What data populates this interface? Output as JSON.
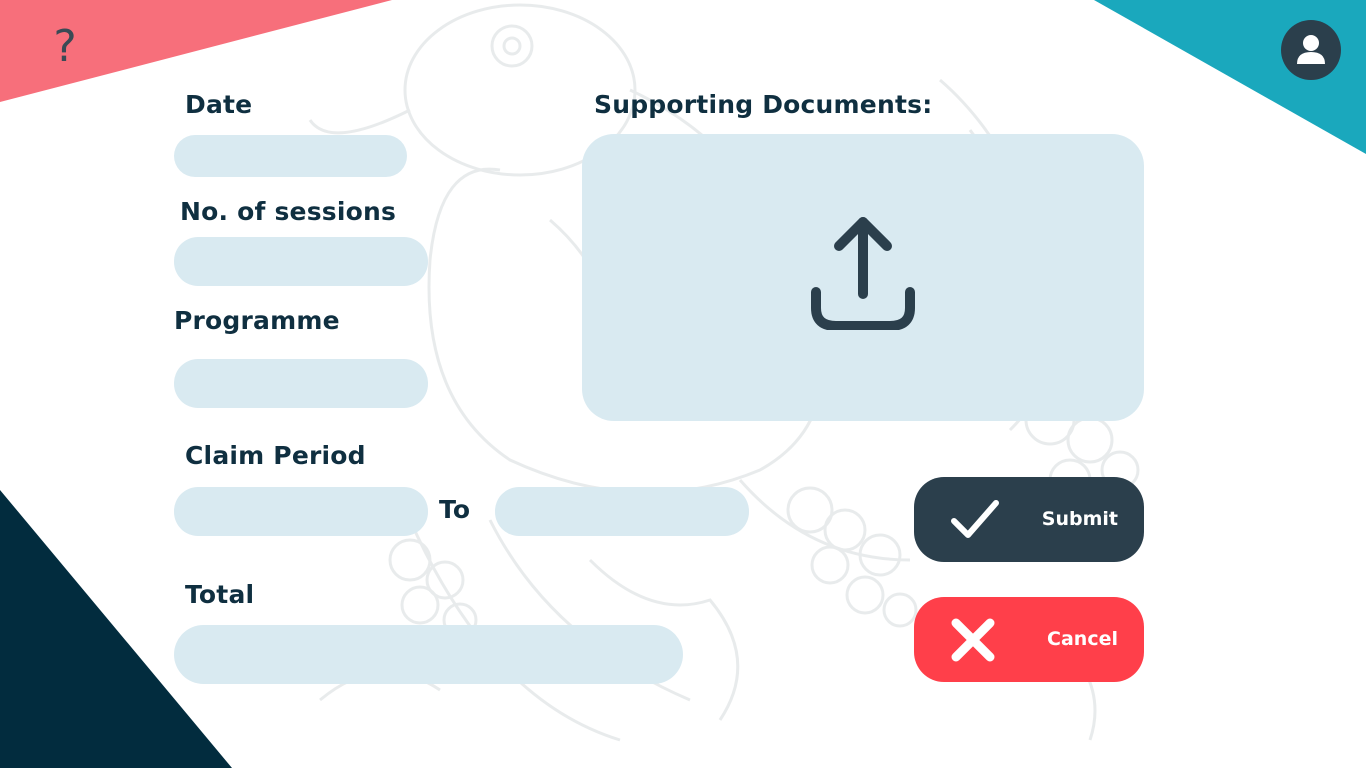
{
  "colors": {
    "accent_pink": "#f76f7b",
    "accent_teal": "#1aa8bd",
    "accent_navy": "#022c3e",
    "field_background": "#d9eaf1",
    "submit_background": "#2b3f4c",
    "cancel_background": "#ff3f4a",
    "text": "#0f2f40"
  },
  "header": {
    "help_icon": "?",
    "avatar_icon": "user-icon"
  },
  "form": {
    "date_label": "Date",
    "date_value": "",
    "sessions_label": "No. of sessions",
    "sessions_value": "",
    "programme_label": "Programme",
    "programme_value": "",
    "claim_period_label": "Claim Period",
    "claim_period_from_value": "",
    "to_label": "To",
    "claim_period_to_value": "",
    "total_label": "Total",
    "total_value": ""
  },
  "documents": {
    "label": "Supporting Documents:",
    "upload_icon": "upload-icon"
  },
  "actions": {
    "submit_label": "Submit",
    "submit_icon": "checkmark-icon",
    "cancel_label": "Cancel",
    "cancel_icon": "close-icon"
  }
}
